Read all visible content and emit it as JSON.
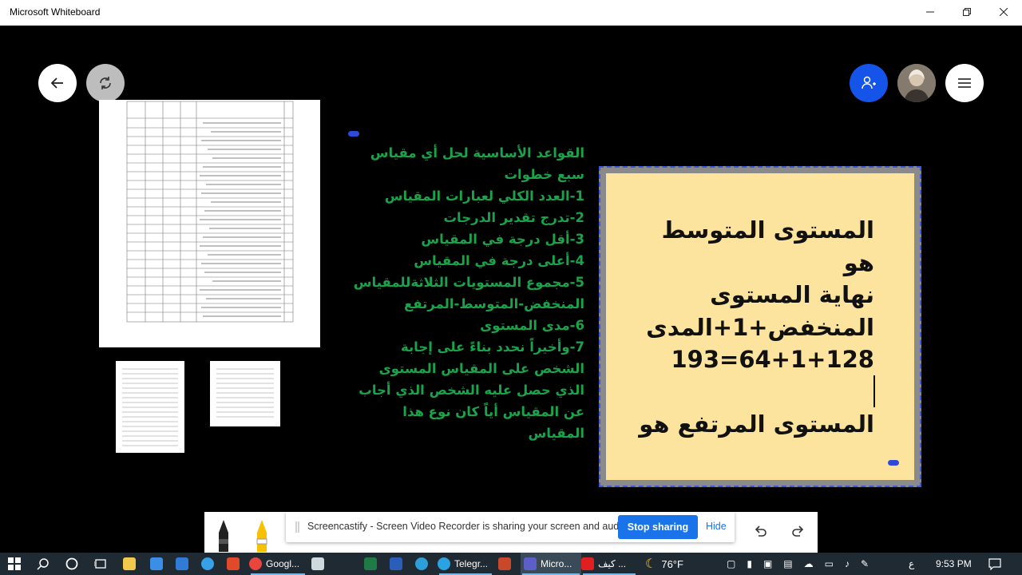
{
  "window": {
    "title": "Microsoft Whiteboard"
  },
  "icons": {
    "back": "arrow-left-icon",
    "sync": "sync-icon",
    "invite": "add-person-icon",
    "menu": "hamburger-menu-icon",
    "minimize": "minimize-icon",
    "restore": "restore-icon",
    "close": "close-icon"
  },
  "green_list": {
    "lines": [
      "القواعد الأساسية لحل أي مقياس",
      "سبع خطوات",
      "1-العدد الكلي لعبارات المقياس",
      "2-تدرج تقدير الدرجات",
      "3-أقل درجة في المقياس",
      "4-أعلى درجة في المقياس",
      "5-مجموع المستويات الثلاثةللمقياس",
      "المنخفض-المتوسط-المرتفع",
      "6-مدى المستوى",
      "7-وأخيراً نحدد بناءً على إجابة",
      "الشخص على المقياس المستوى",
      "الذي حصل عليه الشخص الذي أجاب",
      "عن المقياس أياً كان نوع هذا",
      "المقياس"
    ]
  },
  "note": {
    "lines": [
      "المستوى المتوسط",
      "هو",
      "نهاية المستوى",
      "المنخفض+1+المدى",
      "193=64+1+128",
      "",
      "المستوى المرتفع هو"
    ]
  },
  "share_bar": {
    "message": "Screencastify - Screen Video Recorder is sharing your screen and audio.",
    "stop_label": "Stop sharing",
    "hide_label": "Hide"
  },
  "taskbar": {
    "items": [
      {
        "label": "Googl...",
        "color": "#e8453c"
      },
      {
        "label": "Telegr...",
        "color": "#2aa3e0"
      },
      {
        "label": "Micro...",
        "color": "#5b5fc7"
      },
      {
        "label": "كيف ...",
        "color": "#e02020"
      }
    ],
    "weather": "76°F",
    "language": "ع",
    "time": "9:53 PM"
  },
  "colors": {
    "accent_blue": "#1a73e8",
    "green_text": "#1aa34a",
    "note_bg": "#fde49e",
    "invite_blue": "#1554e8"
  }
}
